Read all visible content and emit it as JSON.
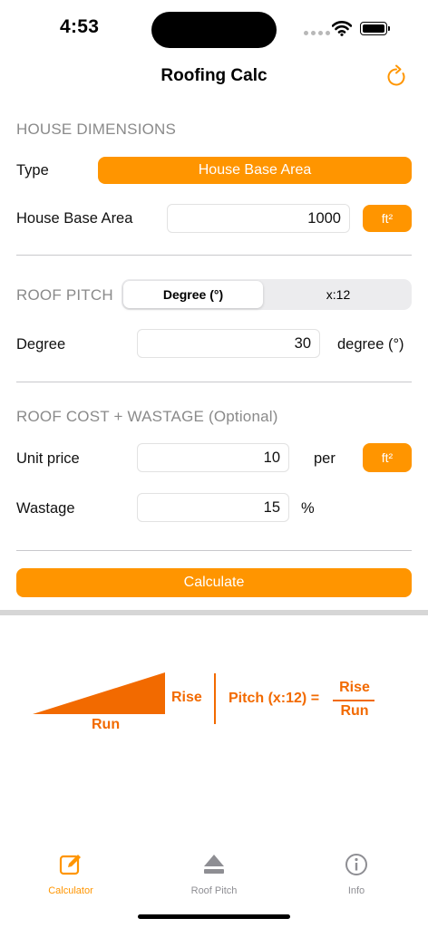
{
  "status_bar": {
    "time": "4:53"
  },
  "nav": {
    "title": "Roofing Calc",
    "refresh_icon": "arrow-clockwise-icon"
  },
  "house": {
    "header": "HOUSE DIMENSIONS",
    "type_label": "Type",
    "type_value": "House Base Area",
    "area_label": "House Base Area",
    "area_value": "1000",
    "area_unit": "ft²"
  },
  "pitch": {
    "header": "ROOF PITCH",
    "segments": [
      "Degree (°)",
      "x:12"
    ],
    "selected_segment": "Degree (°)",
    "degree_label": "Degree",
    "degree_value": "30",
    "degree_unit": "degree (°)"
  },
  "cost": {
    "header": "ROOF COST + WASTAGE (Optional)",
    "price_label": "Unit price",
    "price_value": "10",
    "per_text": "per",
    "price_unit": "ft²",
    "wastage_label": "Wastage",
    "wastage_value": "15",
    "wastage_unit": "%"
  },
  "calculate_label": "Calculate",
  "diagram": {
    "rise": "Rise",
    "run": "Run",
    "formula": "Pitch (x:12) =",
    "numerator": "Rise",
    "denominator": "Run"
  },
  "tabs": [
    {
      "label": "Calculator",
      "icon": "square-pencil-icon",
      "active": true
    },
    {
      "label": "Roof Pitch",
      "icon": "eject-icon",
      "active": false
    },
    {
      "label": "Info",
      "icon": "info-circle-icon",
      "active": false
    }
  ],
  "colors": {
    "accent": "#ff9500",
    "diagram": "#f26a00",
    "inactive_tab": "#8e8e93"
  }
}
